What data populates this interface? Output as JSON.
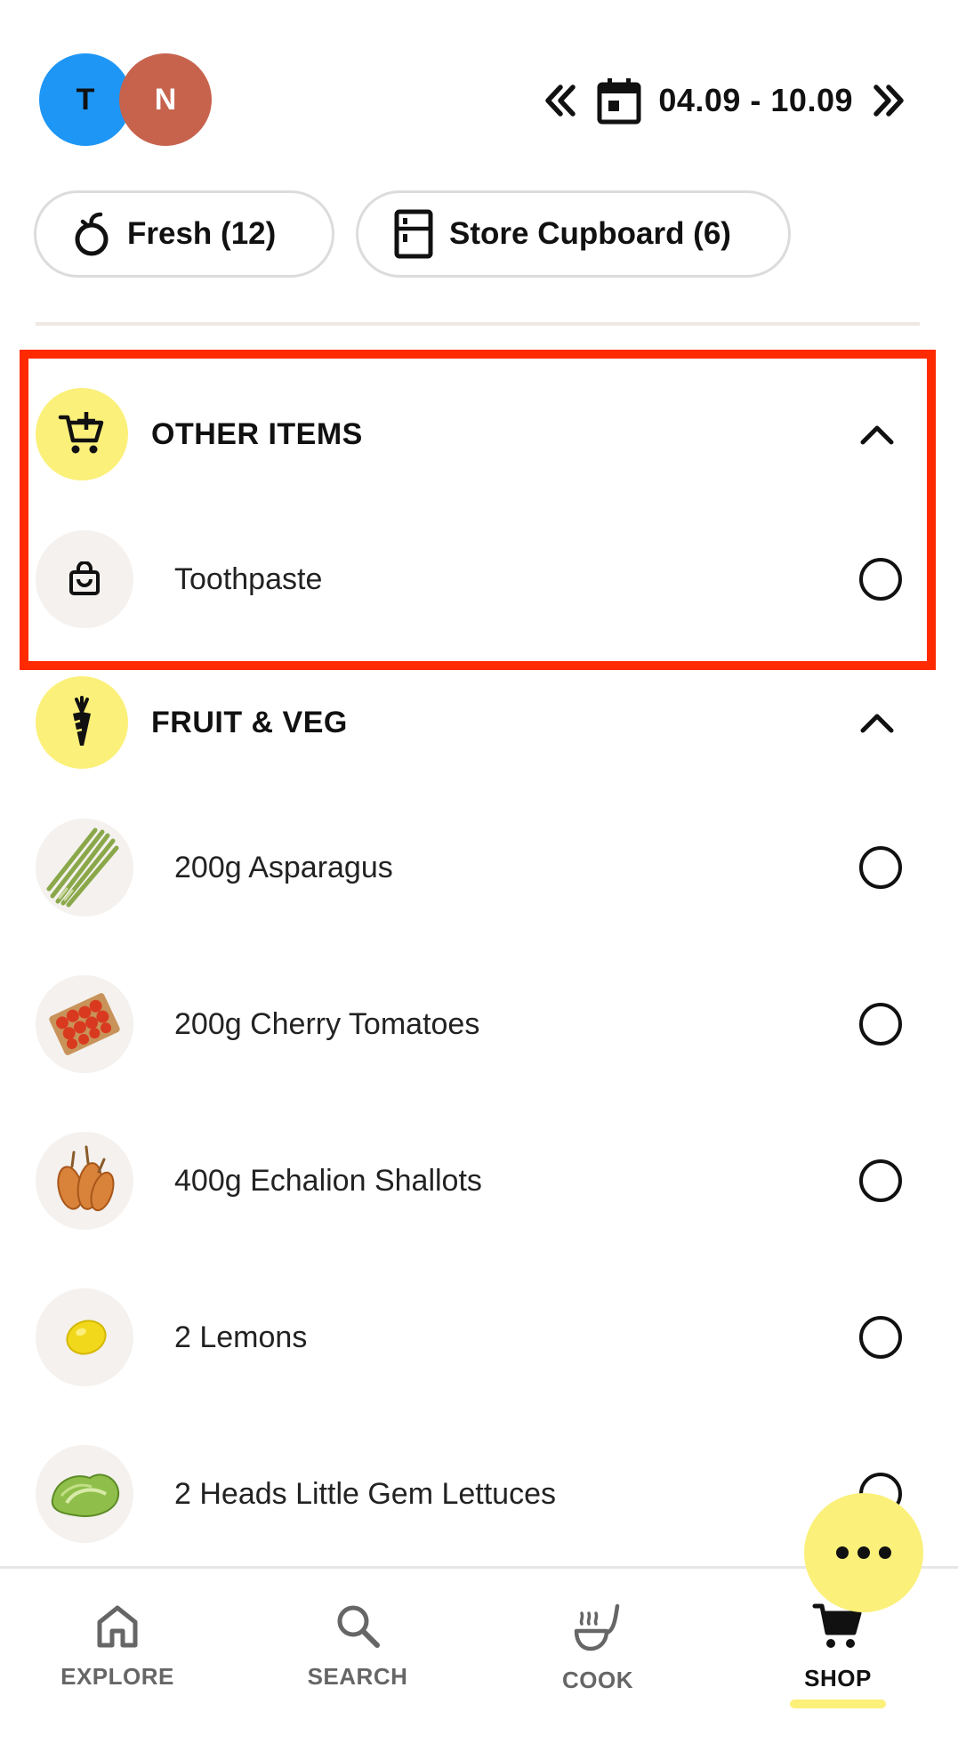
{
  "header": {
    "avatars": [
      "T",
      "N"
    ],
    "date_range": "04.09 - 10.09"
  },
  "filters": [
    {
      "label": "Fresh (12)",
      "icon": "apple-icon"
    },
    {
      "label": "Store Cupboard (6)",
      "icon": "cupboard-icon"
    }
  ],
  "sections": [
    {
      "title": "OTHER ITEMS",
      "icon": "cart-plus-icon",
      "items": [
        {
          "label": "Toothpaste",
          "icon": "bag-icon"
        }
      ]
    },
    {
      "title": "FRUIT & VEG",
      "icon": "carrot-icon",
      "items": [
        {
          "label": "200g Asparagus"
        },
        {
          "label": "200g Cherry Tomatoes"
        },
        {
          "label": "400g Echalion Shallots"
        },
        {
          "label": "2 Lemons"
        },
        {
          "label": "2 Heads Little Gem Lettuces"
        }
      ]
    }
  ],
  "nav": [
    {
      "label": "EXPLORE",
      "icon": "home-icon"
    },
    {
      "label": "SEARCH",
      "icon": "search-icon"
    },
    {
      "label": "COOK",
      "icon": "cook-icon"
    },
    {
      "label": "SHOP",
      "icon": "cart-icon",
      "active": true
    }
  ],
  "colors": {
    "accent_yellow": "#fbf07a",
    "highlight_red": "#ff2a00",
    "avatar_t": "#1e96f5",
    "avatar_n": "#c7634d"
  }
}
